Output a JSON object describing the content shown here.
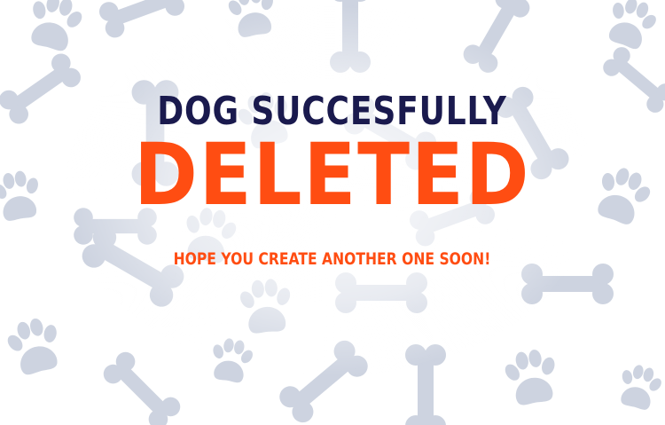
{
  "message": {
    "title_line1": "DOG SUCCESFULLY",
    "title_line2": "DELETED",
    "subtitle": "HOPE YOU CREATE ANOTHER ONE SOON!"
  },
  "colors": {
    "background": "#ffffff",
    "title_line1": "#1a1a4e",
    "accent": "#ff4d12",
    "pattern": "#a7b3c9"
  },
  "background_pattern": {
    "icons": [
      "bone-icon",
      "paw-icon"
    ]
  }
}
